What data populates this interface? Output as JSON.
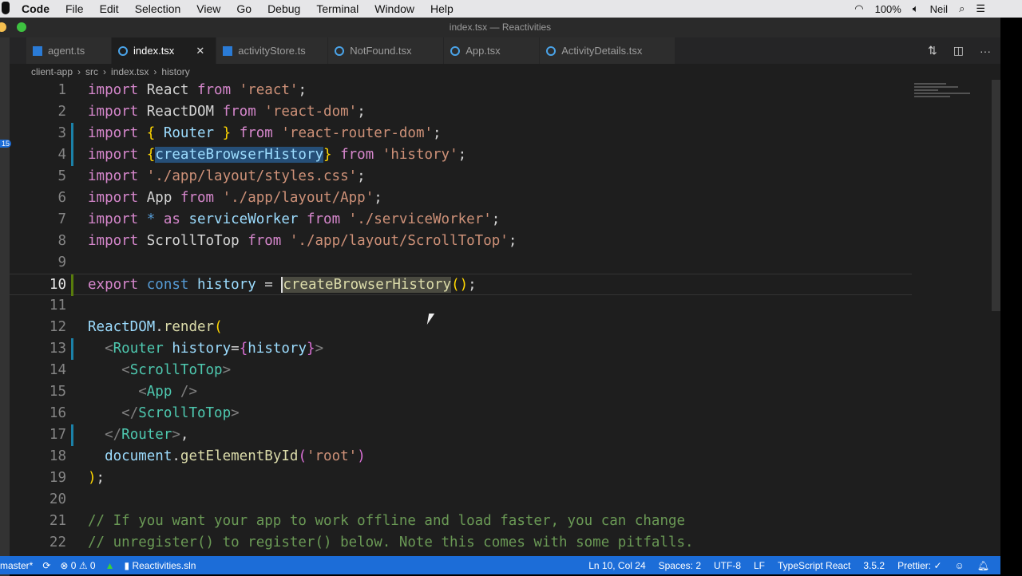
{
  "menubar": {
    "app": "Code",
    "items": [
      "File",
      "Edit",
      "Selection",
      "View",
      "Go",
      "Debug",
      "Terminal",
      "Window",
      "Help"
    ],
    "battery": "100%",
    "user": "Neil"
  },
  "window": {
    "title": "index.tsx — Reactivities"
  },
  "tabs": [
    {
      "label": "agent.ts",
      "icon": "ts",
      "active": false
    },
    {
      "label": "index.tsx",
      "icon": "react",
      "active": true
    },
    {
      "label": "activityStore.ts",
      "icon": "ts",
      "active": false
    },
    {
      "label": "NotFound.tsx",
      "icon": "react",
      "active": false
    },
    {
      "label": "App.tsx",
      "icon": "react",
      "active": false
    },
    {
      "label": "ActivityDetails.tsx",
      "icon": "react",
      "active": false
    }
  ],
  "breadcrumb": [
    "client-app",
    "src",
    "index.tsx",
    "history"
  ],
  "activity_badge": "15",
  "code": [
    [
      [
        "k",
        "import "
      ],
      [
        "i",
        "React "
      ],
      [
        "k",
        "from "
      ],
      [
        "s",
        "'react'"
      ],
      [
        "p",
        ";"
      ]
    ],
    [
      [
        "k",
        "import "
      ],
      [
        "i",
        "ReactDOM "
      ],
      [
        "k",
        "from "
      ],
      [
        "s",
        "'react-dom'"
      ],
      [
        "p",
        ";"
      ]
    ],
    [
      [
        "k",
        "import "
      ],
      [
        "b",
        "{ "
      ],
      [
        "v",
        "Router "
      ],
      [
        "b",
        "} "
      ],
      [
        "k",
        "from "
      ],
      [
        "s",
        "'react-router-dom'"
      ],
      [
        "p",
        ";"
      ]
    ],
    [
      [
        "k",
        "import "
      ],
      [
        "b",
        "{"
      ],
      [
        "v sel",
        "createBrowserHistory"
      ],
      [
        "b",
        "} "
      ],
      [
        "k",
        "from "
      ],
      [
        "s",
        "'history'"
      ],
      [
        "p",
        ";"
      ]
    ],
    [
      [
        "k",
        "import "
      ],
      [
        "s",
        "'./app/layout/styles.css'"
      ],
      [
        "p",
        ";"
      ]
    ],
    [
      [
        "k",
        "import "
      ],
      [
        "i",
        "App "
      ],
      [
        "k",
        "from "
      ],
      [
        "s",
        "'./app/layout/App'"
      ],
      [
        "p",
        ";"
      ]
    ],
    [
      [
        "k",
        "import "
      ],
      [
        "kc",
        "* "
      ],
      [
        "k",
        "as "
      ],
      [
        "v",
        "serviceWorker "
      ],
      [
        "k",
        "from "
      ],
      [
        "s",
        "'./serviceWorker'"
      ],
      [
        "p",
        ";"
      ]
    ],
    [
      [
        "k",
        "import "
      ],
      [
        "i",
        "ScrollToTop "
      ],
      [
        "k",
        "from "
      ],
      [
        "s",
        "'./app/layout/ScrollToTop'"
      ],
      [
        "p",
        ";"
      ]
    ],
    [],
    [
      [
        "k",
        "export "
      ],
      [
        "kc",
        "const "
      ],
      [
        "v",
        "history "
      ],
      [
        "p",
        "= "
      ],
      [
        "f hl caret",
        "createBrowserHistory"
      ],
      [
        "b",
        "()"
      ],
      [
        "p",
        ";"
      ]
    ],
    [],
    [
      [
        "v",
        "ReactDOM"
      ],
      [
        "p",
        "."
      ],
      [
        "f",
        "render"
      ],
      [
        "b",
        "("
      ]
    ],
    [
      [
        "p",
        "  "
      ],
      [
        "g",
        "<"
      ],
      [
        "t",
        "Router "
      ],
      [
        "v",
        "history"
      ],
      [
        "p",
        "="
      ],
      [
        "m",
        "{"
      ],
      [
        "v",
        "history"
      ],
      [
        "m",
        "}"
      ],
      [
        "g",
        ">"
      ]
    ],
    [
      [
        "p",
        "    "
      ],
      [
        "g",
        "<"
      ],
      [
        "t",
        "ScrollToTop"
      ],
      [
        "g",
        ">"
      ]
    ],
    [
      [
        "p",
        "      "
      ],
      [
        "g",
        "<"
      ],
      [
        "t",
        "App "
      ],
      [
        "g",
        "/>"
      ]
    ],
    [
      [
        "p",
        "    "
      ],
      [
        "g",
        "</"
      ],
      [
        "t",
        "ScrollToTop"
      ],
      [
        "g",
        ">"
      ]
    ],
    [
      [
        "p",
        "  "
      ],
      [
        "g",
        "</"
      ],
      [
        "t",
        "Router"
      ],
      [
        "g",
        ">"
      ],
      [
        "p",
        ","
      ]
    ],
    [
      [
        "p",
        "  "
      ],
      [
        "v",
        "document"
      ],
      [
        "p",
        "."
      ],
      [
        "f",
        "getElementById"
      ],
      [
        "m",
        "("
      ],
      [
        "s",
        "'root'"
      ],
      [
        "m",
        ")"
      ]
    ],
    [
      [
        "b",
        ")"
      ],
      [
        "p",
        ";"
      ]
    ],
    [],
    [
      [
        "c",
        "// If you want your app to work offline and load faster, you can change"
      ]
    ],
    [
      [
        "c",
        "// unregister() to register() below. Note this comes with some pitfalls."
      ]
    ]
  ],
  "current_line": 10,
  "status": {
    "branch": "master*",
    "errors": "0",
    "warnings": "0",
    "solution": "Reactivities.sln",
    "position": "Ln 10, Col 24",
    "spaces": "Spaces: 2",
    "encoding": "UTF-8",
    "eol": "LF",
    "language": "TypeScript React",
    "version": "3.5.2",
    "prettier": "Prettier: ✓"
  }
}
